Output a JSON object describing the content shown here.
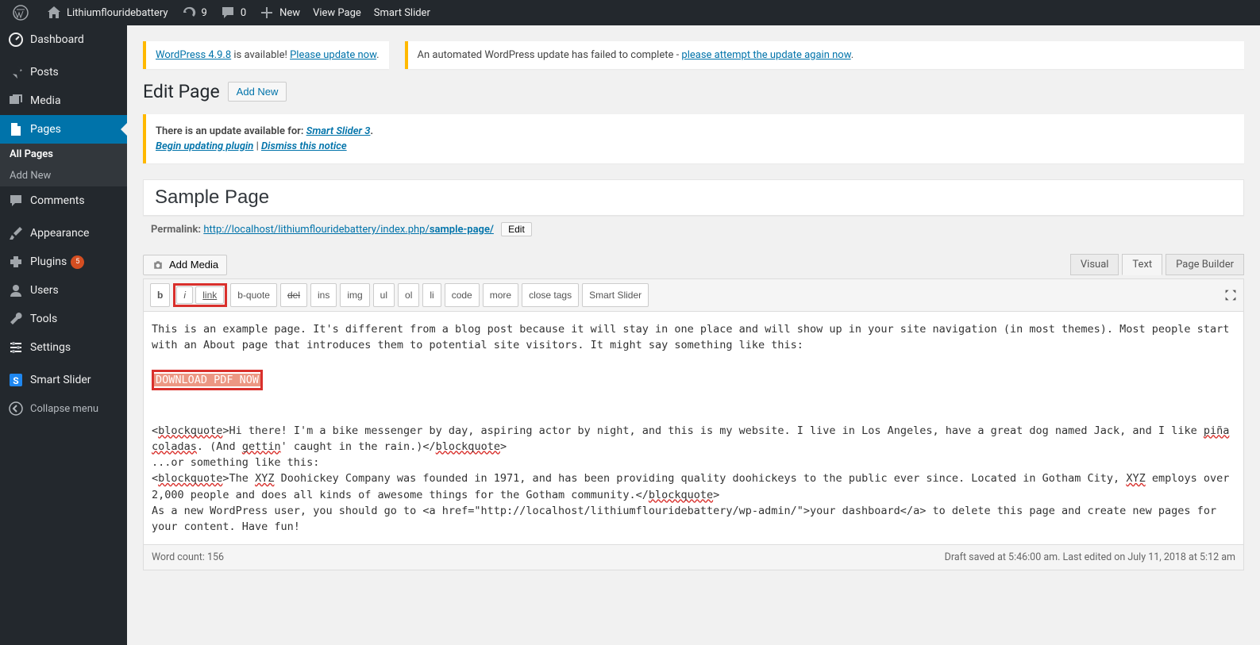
{
  "adminbar": {
    "site_name": "Lithiumflouridebattery",
    "updates_count": "9",
    "comments_count": "0",
    "new_label": "New",
    "view_page": "View Page",
    "smart_slider": "Smart Slider"
  },
  "sidebar": {
    "dashboard": "Dashboard",
    "posts": "Posts",
    "media": "Media",
    "pages": "Pages",
    "all_pages": "All Pages",
    "add_new": "Add New",
    "comments": "Comments",
    "appearance": "Appearance",
    "plugins": "Plugins",
    "plugins_count": "5",
    "users": "Users",
    "tools": "Tools",
    "settings": "Settings",
    "smart_slider": "Smart Slider",
    "collapse": "Collapse menu"
  },
  "notices": {
    "wp_version": "WordPress 4.9.8",
    "wp_available": " is available! ",
    "update_now": "Please update now",
    "auto_fail": "An automated WordPress update has failed to complete - ",
    "attempt_again": "please attempt the update again now"
  },
  "heading": {
    "title": "Edit Page",
    "add_new": "Add New"
  },
  "update_notice": {
    "prefix": "There is an update available for: ",
    "plugin": "Smart Slider 3",
    "begin": "Begin updating plugin",
    "sep": " | ",
    "dismiss": "Dismiss this notice"
  },
  "editor": {
    "title_value": "Sample Page",
    "permalink_label": "Permalink: ",
    "permalink_base": "http://localhost/lithiumflouridebattery/index.php/",
    "permalink_slug": "sample-page/",
    "edit_btn": "Edit",
    "add_media": "Add Media",
    "tabs": {
      "visual": "Visual",
      "text": "Text",
      "builder": "Page Builder"
    },
    "toolbar": {
      "b": "b",
      "i": "i",
      "link": "link",
      "bquote": "b-quote",
      "del": "del",
      "ins": "ins",
      "img": "img",
      "ul": "ul",
      "ol": "ol",
      "li": "li",
      "code": "code",
      "more": "more",
      "close": "close tags",
      "ss": "Smart Slider"
    },
    "content": {
      "p1": "This is an example page. It's different from a blog post because it will stay in one place and will show up in your site navigation (in most themes). Most people start with an About page that introduces them to potential site visitors. It might say something like this:",
      "download": "DOWNLOAD PDF NOW",
      "bq1_open": "<",
      "bq_word": "blockquote",
      "bq1_mid": ">Hi there! I'm a bike messenger by day, aspiring actor by night, and this is my website. I live in Los Angeles, have a great dog named Jack, and I like ",
      "pina": "piña",
      "coladas": "coladas",
      "gettin": "gettin",
      "bq1_tail1": ". (And ",
      "bq1_tail2": "' caught in the rain.)</",
      "bq1_close": ">",
      "or": "...or something like this:",
      "bq2_open": "<",
      "bq2_mid1": ">The ",
      "xyz": "XYZ",
      "bq2_mid2": " Doohickey Company was founded in 1971, and has been providing quality doohickeys to the public ever since. Located in Gotham City, ",
      "bq2_mid3": " employs over 2,000 people and does all kinds of awesome things for the Gotham community.</",
      "bq2_close": ">",
      "p2": "As a new WordPress user, you should go to <a href=\"http://localhost/lithiumflouridebattery/wp-admin/\">your dashboard</a> to delete this page and create new pages for your content. Have fun!"
    },
    "footer": {
      "word_count_label": "Word count: ",
      "word_count": "156",
      "status": "Draft saved at 5:46:00 am. Last edited on July 11, 2018 at 5:12 am"
    }
  }
}
